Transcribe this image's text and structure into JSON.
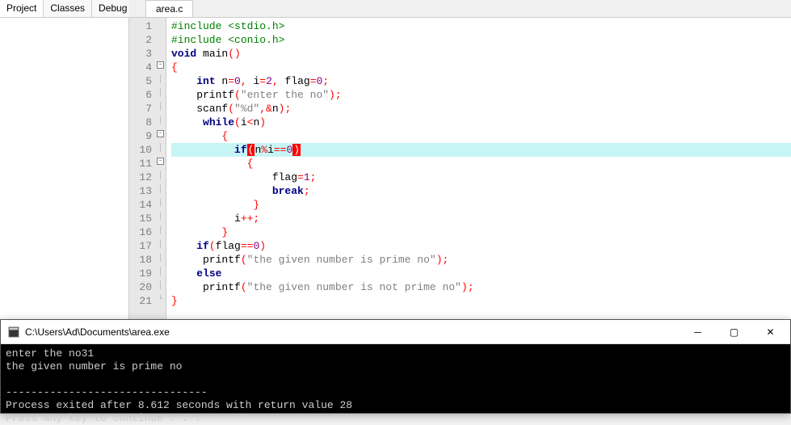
{
  "left_panel": {
    "tabs": [
      "Project",
      "Classes",
      "Debug"
    ],
    "active": 0
  },
  "editor": {
    "filename": "area.c",
    "highlighted_line": 10,
    "lines": [
      {
        "n": 1,
        "fold": "",
        "tokens": [
          [
            "pp",
            "#include <stdio.h>"
          ]
        ]
      },
      {
        "n": 2,
        "fold": "",
        "tokens": [
          [
            "pp",
            "#include <conio.h>"
          ]
        ]
      },
      {
        "n": 3,
        "fold": "",
        "tokens": [
          [
            "kw",
            "void"
          ],
          [
            "",
            " main"
          ],
          [
            "op",
            "()"
          ]
        ]
      },
      {
        "n": 4,
        "fold": "box",
        "tokens": [
          [
            "brace",
            "{"
          ]
        ]
      },
      {
        "n": 5,
        "fold": "line",
        "tokens": [
          [
            "",
            "    "
          ],
          [
            "kw",
            "int"
          ],
          [
            "",
            " n"
          ],
          [
            "op",
            "="
          ],
          [
            "num",
            "0"
          ],
          [
            "op",
            ","
          ],
          [
            "",
            " i"
          ],
          [
            "op",
            "="
          ],
          [
            "num",
            "2"
          ],
          [
            "op",
            ","
          ],
          [
            "",
            " flag"
          ],
          [
            "op",
            "="
          ],
          [
            "num",
            "0"
          ],
          [
            "op",
            ";"
          ]
        ]
      },
      {
        "n": 6,
        "fold": "line",
        "tokens": [
          [
            "",
            "    printf"
          ],
          [
            "op",
            "("
          ],
          [
            "str",
            "\"enter the no\""
          ],
          [
            "op",
            ");"
          ]
        ]
      },
      {
        "n": 7,
        "fold": "line",
        "tokens": [
          [
            "",
            "    scanf"
          ],
          [
            "op",
            "("
          ],
          [
            "str",
            "\"%d\""
          ],
          [
            "op",
            ",&"
          ],
          [
            "",
            "n"
          ],
          [
            "op",
            ");"
          ]
        ]
      },
      {
        "n": 8,
        "fold": "line",
        "tokens": [
          [
            "",
            "     "
          ],
          [
            "kw",
            "while"
          ],
          [
            "op",
            "("
          ],
          [
            "",
            "i"
          ],
          [
            "op",
            "<"
          ],
          [
            "",
            "n"
          ],
          [
            "op",
            ")"
          ]
        ]
      },
      {
        "n": 9,
        "fold": "box",
        "tokens": [
          [
            "",
            "        "
          ],
          [
            "brace",
            "{"
          ]
        ]
      },
      {
        "n": 10,
        "fold": "line",
        "tokens": [
          [
            "",
            "          "
          ],
          [
            "kw",
            "if"
          ],
          [
            "br-hl",
            "("
          ],
          [
            "",
            "n"
          ],
          [
            "op",
            "%"
          ],
          [
            "",
            "i"
          ],
          [
            "op",
            "=="
          ],
          [
            "num",
            "0"
          ],
          [
            "br-hl",
            ")"
          ]
        ]
      },
      {
        "n": 11,
        "fold": "box",
        "tokens": [
          [
            "",
            "            "
          ],
          [
            "brace",
            "{"
          ]
        ]
      },
      {
        "n": 12,
        "fold": "line",
        "tokens": [
          [
            "",
            "                flag"
          ],
          [
            "op",
            "="
          ],
          [
            "num",
            "1"
          ],
          [
            "op",
            ";"
          ]
        ]
      },
      {
        "n": 13,
        "fold": "line",
        "tokens": [
          [
            "",
            "                "
          ],
          [
            "kw",
            "break"
          ],
          [
            "op",
            ";"
          ]
        ]
      },
      {
        "n": 14,
        "fold": "line",
        "tokens": [
          [
            "",
            "             "
          ],
          [
            "brace",
            "}"
          ]
        ]
      },
      {
        "n": 15,
        "fold": "line",
        "tokens": [
          [
            "",
            "          i"
          ],
          [
            "op",
            "++;"
          ]
        ]
      },
      {
        "n": 16,
        "fold": "line",
        "tokens": [
          [
            "",
            "        "
          ],
          [
            "brace",
            "}"
          ]
        ]
      },
      {
        "n": 17,
        "fold": "line",
        "tokens": [
          [
            "",
            "    "
          ],
          [
            "kw",
            "if"
          ],
          [
            "op",
            "("
          ],
          [
            "",
            "flag"
          ],
          [
            "op",
            "=="
          ],
          [
            "num",
            "0"
          ],
          [
            "op",
            ")"
          ]
        ]
      },
      {
        "n": 18,
        "fold": "line",
        "tokens": [
          [
            "",
            "     printf"
          ],
          [
            "op",
            "("
          ],
          [
            "str",
            "\"the given number is prime no\""
          ],
          [
            "op",
            ");"
          ]
        ]
      },
      {
        "n": 19,
        "fold": "line",
        "tokens": [
          [
            "",
            "    "
          ],
          [
            "kw",
            "else"
          ]
        ]
      },
      {
        "n": 20,
        "fold": "line",
        "tokens": [
          [
            "",
            "     printf"
          ],
          [
            "op",
            "("
          ],
          [
            "str",
            "\"the given number is not prime no\""
          ],
          [
            "op",
            ");"
          ]
        ]
      },
      {
        "n": 21,
        "fold": "end",
        "tokens": [
          [
            "brace",
            "}"
          ]
        ]
      }
    ]
  },
  "console": {
    "title": "C:\\Users\\Ad\\Documents\\area.exe",
    "lines": [
      "enter the no31",
      "the given number is prime no",
      "",
      "--------------------------------",
      "Process exited after 8.612 seconds with return value 28",
      "Press any key to continue . . ."
    ]
  }
}
